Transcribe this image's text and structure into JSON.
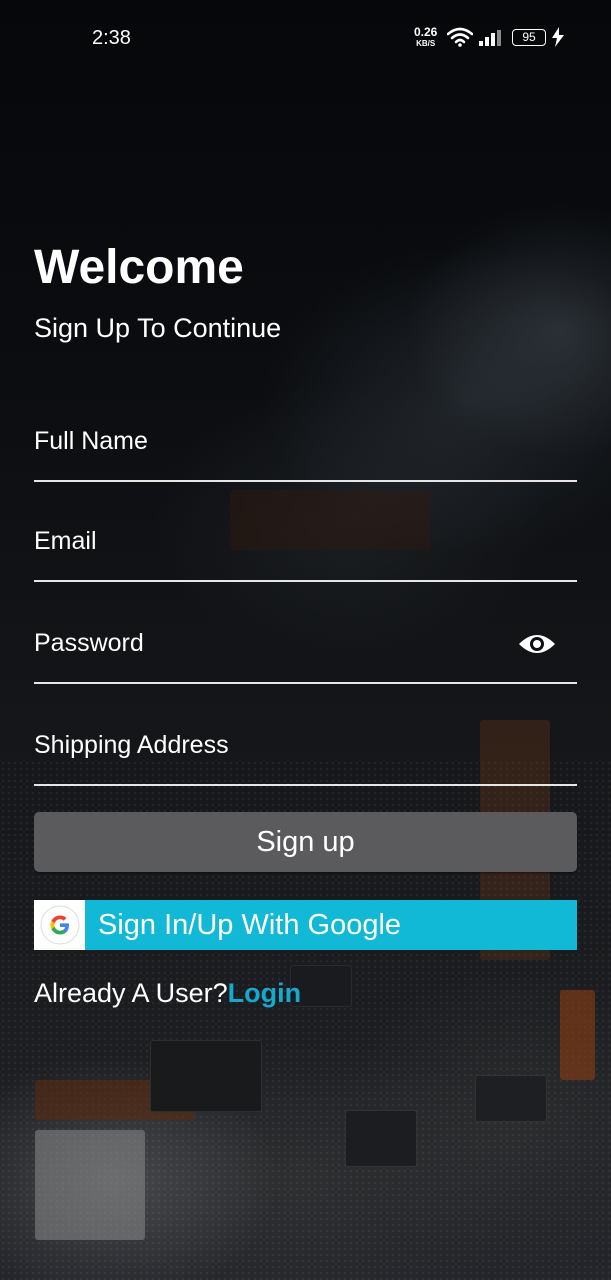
{
  "status_bar": {
    "time": "2:38",
    "net_speed": "0.26",
    "net_speed_unit": "KB/S",
    "battery": "95",
    "icons": [
      "wifi-icon",
      "signal-icon",
      "battery-icon",
      "charging-icon"
    ]
  },
  "header": {
    "title": "Welcome",
    "subtitle": "Sign Up To Continue"
  },
  "form": {
    "fields": [
      {
        "label": "Full Name"
      },
      {
        "label": "Email"
      },
      {
        "label": "Password",
        "icon": "eye-icon"
      },
      {
        "label": "Shipping Address"
      }
    ],
    "signup_label": "Sign up",
    "google_label": "Sign In/Up With Google"
  },
  "footer": {
    "prompt": "Already A User?",
    "login_label": "Login"
  },
  "colors": {
    "accent": "#12b9d6",
    "link": "#16a9cf",
    "button": "#5b5b5d"
  }
}
